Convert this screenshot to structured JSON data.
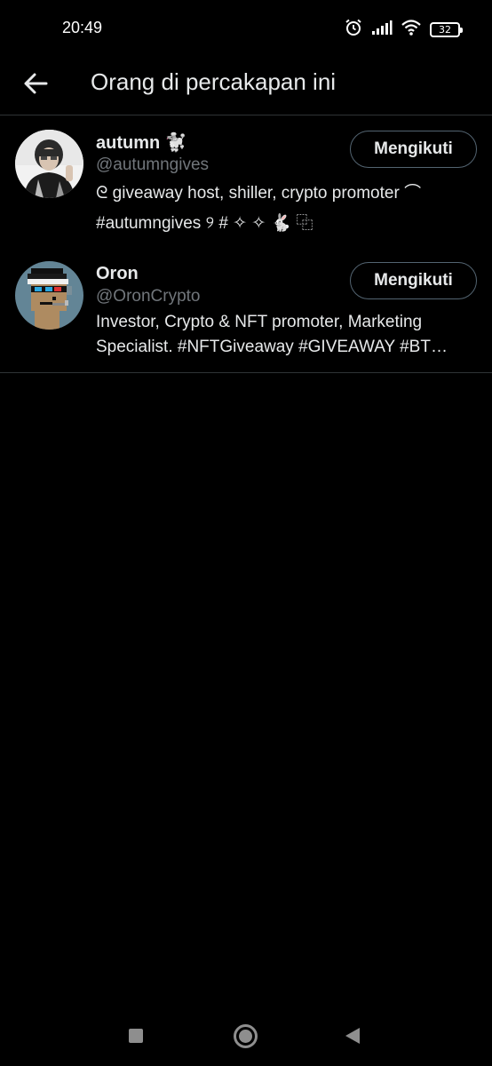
{
  "status_bar": {
    "time": "20:49",
    "battery_level": "32",
    "icons": [
      "alarm-icon",
      "signal-icon",
      "wifi-icon",
      "battery-icon"
    ]
  },
  "header": {
    "back_icon": "arrow-left-icon",
    "title": "Orang di percakapan ini"
  },
  "users": [
    {
      "display_name": "autumn 🐩",
      "handle": "@autumngives",
      "bio": "ᘓ giveaway host, shiller, crypto promoter ⌒ #autumngives ୨ # ✧ ✧ 🐇 ⿻",
      "follow_label": "Mengikuti"
    },
    {
      "display_name": "Oron",
      "handle": "@OronCrypto",
      "bio": "Investor, Crypto & NFT promoter, Marketing Specialist. #NFTGiveaway #GIVEAWAY #BT…",
      "follow_label": "Mengikuti"
    }
  ],
  "nav_bar": {
    "icons": [
      "recents-square-icon",
      "home-circle-icon",
      "back-triangle-icon"
    ]
  },
  "colors": {
    "background": "#000000",
    "text_primary": "#e7e9ea",
    "text_secondary": "#71767b",
    "divider": "#2f3336",
    "button_border": "#536471"
  }
}
